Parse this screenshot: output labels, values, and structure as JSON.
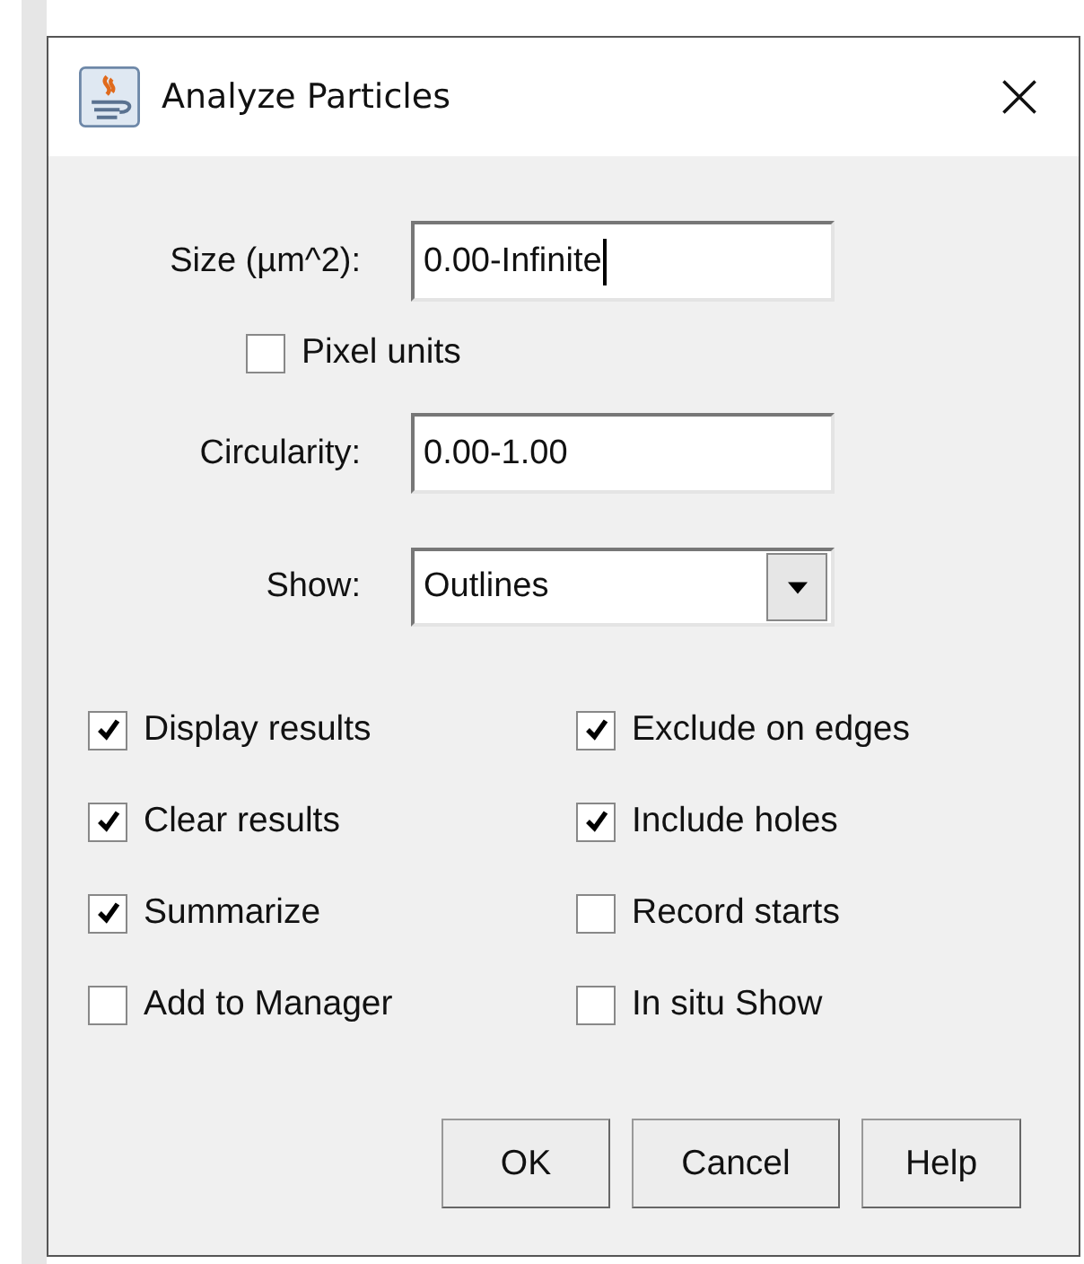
{
  "window": {
    "title": "Analyze Particles"
  },
  "fields": [
    {
      "label": "Size (µm^2):",
      "value": "0.00-Infinite",
      "focused": true
    },
    {
      "label": "Circularity:",
      "value": "0.00-1.00",
      "focused": false
    }
  ],
  "pixel_units": {
    "label": "Pixel units",
    "checked": false
  },
  "show": {
    "label": "Show:",
    "value": "Outlines"
  },
  "options": [
    {
      "label": "Display results",
      "checked": true
    },
    {
      "label": "Exclude on edges",
      "checked": true
    },
    {
      "label": "Clear results",
      "checked": true
    },
    {
      "label": "Include holes",
      "checked": true
    },
    {
      "label": "Summarize",
      "checked": true
    },
    {
      "label": "Record starts",
      "checked": false
    },
    {
      "label": "Add to Manager",
      "checked": false
    },
    {
      "label": "In situ Show",
      "checked": false
    }
  ],
  "buttons": [
    "OK",
    "Cancel",
    "Help"
  ]
}
